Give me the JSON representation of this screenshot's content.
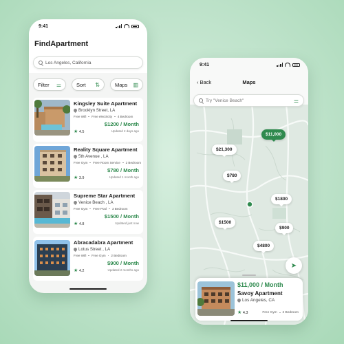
{
  "list_screen": {
    "time": "9:41",
    "title": "FindApartment",
    "search": {
      "value": "Los Angeles, California"
    },
    "filters": [
      {
        "label": "Filter",
        "icon": "sliders-icon"
      },
      {
        "label": "Sort",
        "icon": "sort-arrows-icon"
      },
      {
        "label": "Maps",
        "icon": "map-icon"
      }
    ],
    "listings": [
      {
        "name": "Kingsley Suite Apartment",
        "location": "Brooklyn Street, LA",
        "amenities": [
          "Free Wifi",
          "Free electricity",
          "4 Bedroom"
        ],
        "rating": "4.5",
        "price": "$1200 / Month",
        "updated": "Updated 2 days ago"
      },
      {
        "name": "Reality Square Apartment",
        "location": "5th Avenue , LA",
        "amenities": [
          "Free Gym",
          "Free Room Service",
          "2 Bedroom"
        ],
        "rating": "3.9",
        "price": "$780 / Month",
        "updated": "Updated 1 month ago"
      },
      {
        "name": "Supreme Star Apartment",
        "location": "Venice Beach , LA",
        "amenities": [
          "Free Gym",
          "Free Pool",
          "3 Bedroom"
        ],
        "rating": "4.8",
        "price": "$1500 / Month",
        "updated": "Updated just now"
      },
      {
        "name": "Abracadabra Apartment",
        "location": "Lotus Street , LA",
        "amenities": [
          "Free Wifi",
          "Free Gym",
          "2 Bedroom"
        ],
        "rating": "4.2",
        "price": "$900 / Month",
        "updated": "Updated 2 months ago"
      }
    ]
  },
  "map_screen": {
    "time": "9:41",
    "back_label": "Back",
    "title": "Maps",
    "search": {
      "placeholder": "Try \"Venice Beach\""
    },
    "markers": [
      "$11,000",
      "$21,300",
      "$780",
      "$1800",
      "$1500",
      "$900",
      "$4800"
    ],
    "active_marker": "$11,000",
    "selected": {
      "price": "$11,000 / Month",
      "name": "Savoy Apartment",
      "location": "Los Angeles, CA",
      "rating": "4.3",
      "amenity": "Free Gym",
      "bedrooms": "2 Bedroom"
    }
  },
  "colors": {
    "accent": "#2f8a4e",
    "background": "#bfe3cb"
  }
}
